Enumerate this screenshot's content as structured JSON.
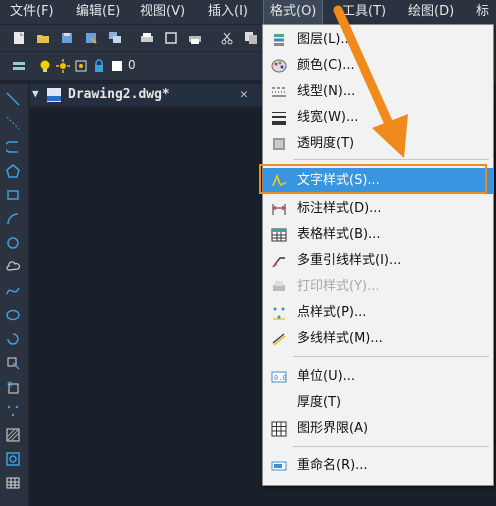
{
  "menubar": {
    "items": [
      {
        "label": "文件(F)"
      },
      {
        "label": "编辑(E)"
      },
      {
        "label": "视图(V)"
      },
      {
        "label": "插入(I)"
      },
      {
        "label": "格式(O)"
      },
      {
        "label": "工具(T)"
      },
      {
        "label": "绘图(D)"
      },
      {
        "label": "标"
      }
    ]
  },
  "toolbar2": {
    "layer_value": "0"
  },
  "document_tab": {
    "title": "Drawing2.dwg*",
    "close": "✕",
    "arrow": "▼"
  },
  "format_menu": {
    "items": [
      {
        "label": "图层(L)...",
        "icon": "layers-icon"
      },
      {
        "label": "颜色(C)...",
        "icon": "palette-icon"
      },
      {
        "label": "线型(N)...",
        "icon": "linetype-icon"
      },
      {
        "label": "线宽(W)...",
        "icon": "lineweight-icon"
      },
      {
        "label": "透明度(T)",
        "icon": "transparency-icon"
      },
      {
        "label": "文字样式(S)...",
        "icon": "text-style-icon",
        "highlighted": true
      },
      {
        "label": "标注样式(D)...",
        "icon": "dim-style-icon"
      },
      {
        "label": "表格样式(B)...",
        "icon": "table-style-icon"
      },
      {
        "label": "多重引线样式(I)...",
        "icon": "mleader-style-icon"
      },
      {
        "label": "打印样式(Y)...",
        "icon": "plot-style-icon",
        "disabled": true
      },
      {
        "label": "点样式(P)...",
        "icon": "point-style-icon"
      },
      {
        "label": "多线样式(M)...",
        "icon": "mline-style-icon"
      },
      {
        "label": "单位(U)...",
        "icon": "units-icon"
      },
      {
        "label": "厚度(T)",
        "icon": "thickness-icon"
      },
      {
        "label": "图形界限(A)",
        "icon": "limits-icon"
      },
      {
        "label": "重命名(R)...",
        "icon": "rename-icon"
      }
    ]
  },
  "colors": {
    "accent_highlight": "#3a95e0",
    "annotation_orange": "#f08a1c"
  }
}
